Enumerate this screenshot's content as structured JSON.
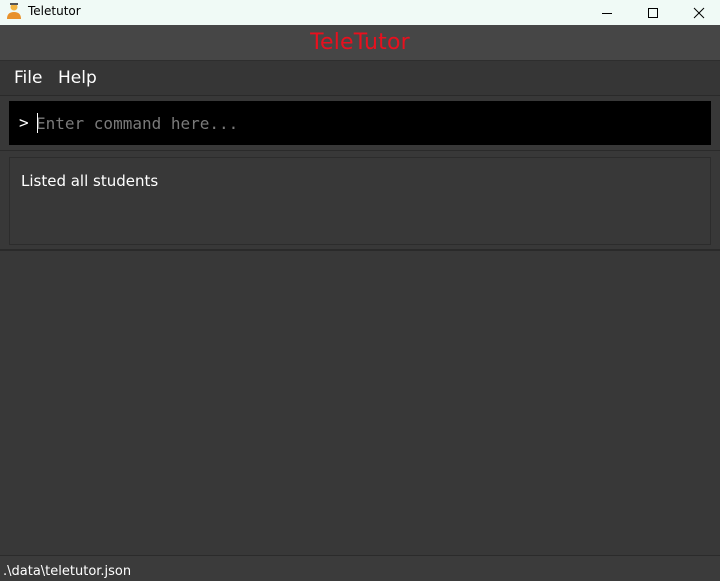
{
  "window": {
    "title": "Teletutor",
    "icon": "student-app-icon",
    "controls": [
      "minimize-icon",
      "maximize-icon",
      "close-icon"
    ]
  },
  "banner": {
    "title": "TeleTutor",
    "color": "#e8101e"
  },
  "menu": {
    "file_label": "File",
    "help_label": "Help"
  },
  "command": {
    "prompt": ">",
    "value": "",
    "placeholder": "Enter command here..."
  },
  "result": {
    "message": "Listed all students"
  },
  "status": {
    "path": ".\\data\\teletutor.json"
  },
  "theme": {
    "background": "#383838",
    "command_box": "#000000",
    "title_bar": "#f0faf6"
  }
}
